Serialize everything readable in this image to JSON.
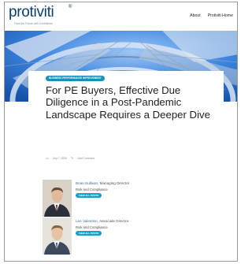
{
  "header": {
    "logo": "protiviti",
    "logo_mark": "®",
    "tagline": "Face the Future with Confidence",
    "nav": [
      {
        "label": "About"
      },
      {
        "label": "Protiviti Home"
      }
    ]
  },
  "article": {
    "category": "BUSINESS PERFORMANCE IMPROVEMENT",
    "title": "For PE Buyers, Effective Due Diligence in a Post-Pandemic Landscape Requires a Deeper Dive",
    "date": "July 7, 2020",
    "comments": "Add Comment"
  },
  "authors": [
    {
      "name": "Brian Sullivan",
      "role": ", Managing Director",
      "area": "Risk and Compliance",
      "button": "VIEW ALL POSTS"
    },
    {
      "name": "Lee Valentine",
      "role": ", Associate Director",
      "area": "Risk and Compliance",
      "button": "VIEW ALL POSTS"
    }
  ],
  "colors": {
    "brand": "#0b3f6e",
    "accent": "#19a0c7",
    "link": "#3a6fb5"
  }
}
